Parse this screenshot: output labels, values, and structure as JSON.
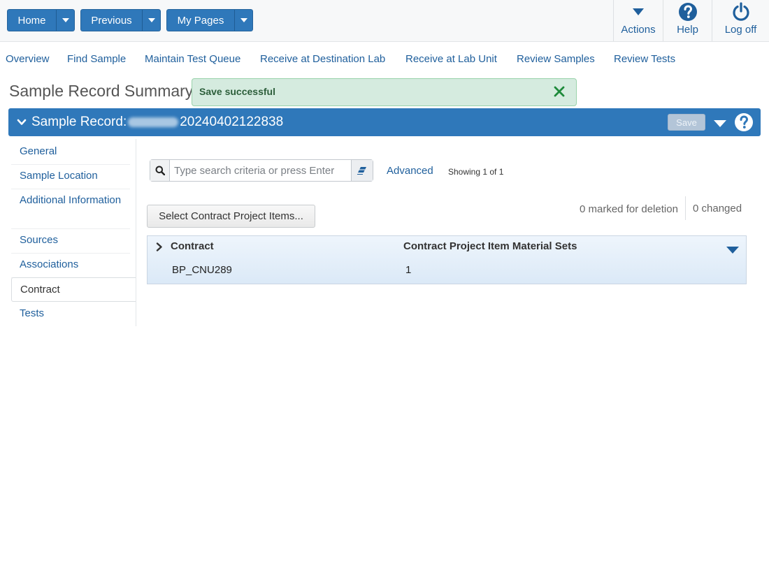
{
  "toolbar": {
    "home_label": "Home",
    "previous_label": "Previous",
    "mypages_label": "My Pages",
    "actions_label": "Actions",
    "help_label": "Help",
    "logoff_label": "Log off"
  },
  "nav": {
    "links": [
      "Overview",
      "Find Sample",
      "Maintain Test Queue",
      "Receive at Destination Lab",
      "Receive at Lab Unit",
      "Review Samples",
      "Review Tests"
    ]
  },
  "page": {
    "title": "Sample Record Summary"
  },
  "toast": {
    "message": "Save successful"
  },
  "record": {
    "label": "Sample Record:",
    "id_suffix": "20240402122838",
    "save_label": "Save"
  },
  "sidebar": {
    "items": [
      "General",
      "Sample Location",
      "Additional Information",
      "Sources",
      "Associations",
      "Contract",
      "Tests"
    ],
    "active": "Contract"
  },
  "search": {
    "placeholder": "Type search criteria or press Enter",
    "value": "",
    "advanced_label": "Advanced",
    "showing_text": "Showing 1 of 1"
  },
  "actions": {
    "select_label": "Select Contract Project Items...",
    "marked_text": "0 marked for deletion",
    "changed_text": "0 changed"
  },
  "grid": {
    "headers": [
      "Contract",
      "Contract Project Item Material Sets"
    ],
    "rows": [
      [
        "BP_CNU289",
        "1"
      ]
    ]
  },
  "colors": {
    "primary": "#2f78ba",
    "link": "#1f5f9c",
    "toast_bg": "#d5ebdf",
    "toast_close": "#1e8a3b"
  }
}
